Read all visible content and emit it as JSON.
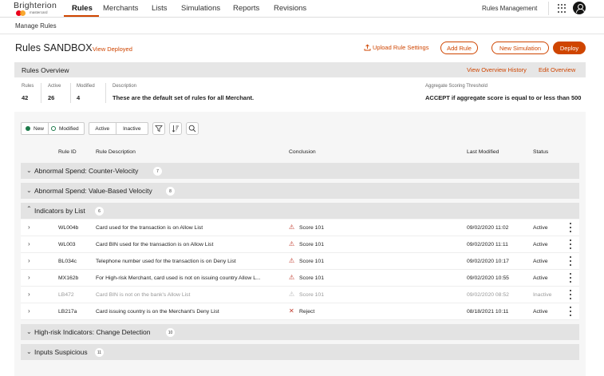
{
  "nav": {
    "brand": "Brighterion",
    "brand_sub": "mastercard",
    "items": [
      "Rules",
      "Merchants",
      "Lists",
      "Simulations",
      "Reports",
      "Revisions"
    ],
    "active": "Rules",
    "right_label": "Rules Management"
  },
  "breadcrumb": "Manage Rules",
  "header": {
    "title": "Rules SANDBOX",
    "view_deployed": "View Deployed",
    "upload": "Upload Rule Settings",
    "add_rule": "Add Rule",
    "new_simulation": "New Simulation",
    "deploy": "Deploy"
  },
  "overview": {
    "title": "Rules Overview",
    "history_link": "View Overview History",
    "edit_link": "Edit Overview",
    "stats": [
      {
        "label": "Rules",
        "value": "42"
      },
      {
        "label": "Active",
        "value": "26"
      },
      {
        "label": "Modified",
        "value": "4"
      }
    ],
    "description_label": "Description",
    "description_value": "These are the default set of rules for all Merchant.",
    "threshold_label": "Aggregate Scoring Threshold",
    "threshold_value": "ACCEPT if aggregate score is equal to or less than 500"
  },
  "filters": {
    "new": "New",
    "modified": "Modified",
    "active": "Active",
    "inactive": "Inactive"
  },
  "columns": {
    "rule_id": "Rule ID",
    "description": "Rule Description",
    "conclusion": "Conclusion",
    "last_modified": "Last Modified",
    "status": "Status"
  },
  "groups": [
    {
      "title": "Abnormal Spend: Counter-Velocity",
      "count": "7"
    },
    {
      "title": "Abnormal Spend: Value-Based Velocity",
      "count": "8"
    },
    {
      "title": "Indicators by List",
      "count": "6"
    },
    {
      "title": "High-risk Indicators: Change Detection",
      "count": "10"
    },
    {
      "title": "Inputs Suspicious",
      "count": "11"
    }
  ],
  "rules": [
    {
      "id": "WL004b",
      "description": "Card used for the transaction is on Allow List",
      "conclusion": "Score 101",
      "modified": "09/02/2020 11:02",
      "status": "Active"
    },
    {
      "id": "WL003",
      "description": "Card BIN used for the transaction is on Allow List",
      "conclusion": "Score 101",
      "modified": "09/02/2020 11:11",
      "status": "Active"
    },
    {
      "id": "BL034c",
      "description": "Telephone number used for the transaction is on Deny List",
      "conclusion": "Score 101",
      "modified": "09/02/2020 10:17",
      "status": "Active"
    },
    {
      "id": "MX162b",
      "description": "For High-risk Merchant, card used is not on issuing country Allow L...",
      "conclusion": "Score 101",
      "modified": "09/02/2020 10:55",
      "status": "Active"
    },
    {
      "id": "LB472",
      "description": "Card BIN is not on the bank's Allow List",
      "conclusion": "Score 101",
      "modified": "09/02/2020 08:52",
      "status": "Inactive"
    },
    {
      "id": "LB217a",
      "description": "Card issuing country is on the Merchant's Deny List",
      "conclusion": "Reject",
      "modified": "08/18/2021 10:11",
      "status": "Active"
    }
  ],
  "colors": {
    "accent": "#cf4500",
    "new_dot": "#1d7a4a",
    "warning": "#c0392b"
  }
}
